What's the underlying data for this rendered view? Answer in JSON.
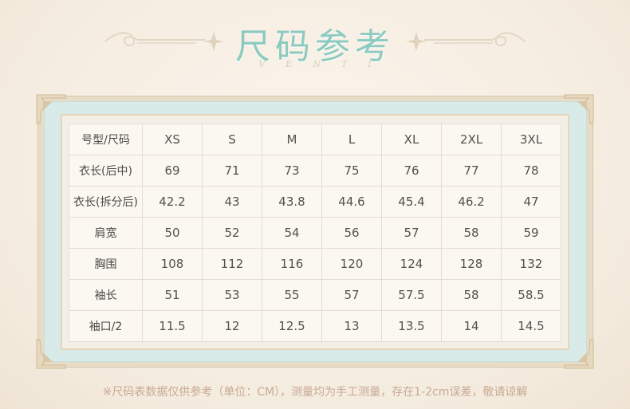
{
  "header": {
    "title": "尺码参考",
    "subtitle": "VENTI"
  },
  "table": {
    "columns": [
      "号型/尺码",
      "XS",
      "S",
      "M",
      "L",
      "XL",
      "2XL",
      "3XL"
    ],
    "rows": [
      [
        "衣长(后中)",
        "69",
        "71",
        "73",
        "75",
        "76",
        "77",
        "78"
      ],
      [
        "衣长(拆分后)",
        "42.2",
        "43",
        "43.8",
        "44.6",
        "45.4",
        "46.2",
        "47"
      ],
      [
        "肩宽",
        "50",
        "52",
        "54",
        "56",
        "57",
        "58",
        "59"
      ],
      [
        "胸围",
        "108",
        "112",
        "116",
        "120",
        "124",
        "128",
        "132"
      ],
      [
        "袖长",
        "51",
        "53",
        "55",
        "57",
        "57.5",
        "58",
        "58.5"
      ],
      [
        "袖口/2",
        "11.5",
        "12",
        "12.5",
        "13",
        "13.5",
        "14",
        "14.5"
      ]
    ]
  },
  "footnote": "※尺码表数据仅供参考（单位：CM），测量均为手工测量，存在1-2cm误差，敬请谅解",
  "colors": {
    "title": "#8ccac0",
    "frame_teal": "#d9ebe8",
    "frame_gold": "#e9dcc7",
    "text": "#54504b",
    "footnote": "#c7a993"
  }
}
